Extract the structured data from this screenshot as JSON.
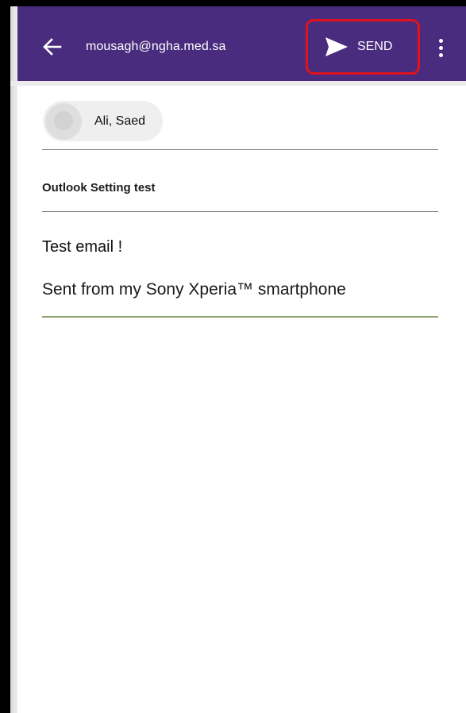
{
  "header": {
    "account_email": "mousagh@ngha.med.sa",
    "send_label": "SEND",
    "back_icon": "arrow-left-icon",
    "send_icon": "send-icon",
    "more_icon": "more-vert-icon"
  },
  "compose": {
    "recipients": [
      {
        "name": "Ali, Saed"
      }
    ],
    "subject": "Outlook Setting test",
    "body_lines": [
      "Test email !",
      "Sent from my Sony Xperia™ smartphone"
    ]
  },
  "colors": {
    "app_bar": "#4a2c7e",
    "highlight": "#e0131c",
    "focus_underline": "#8aa56c"
  }
}
